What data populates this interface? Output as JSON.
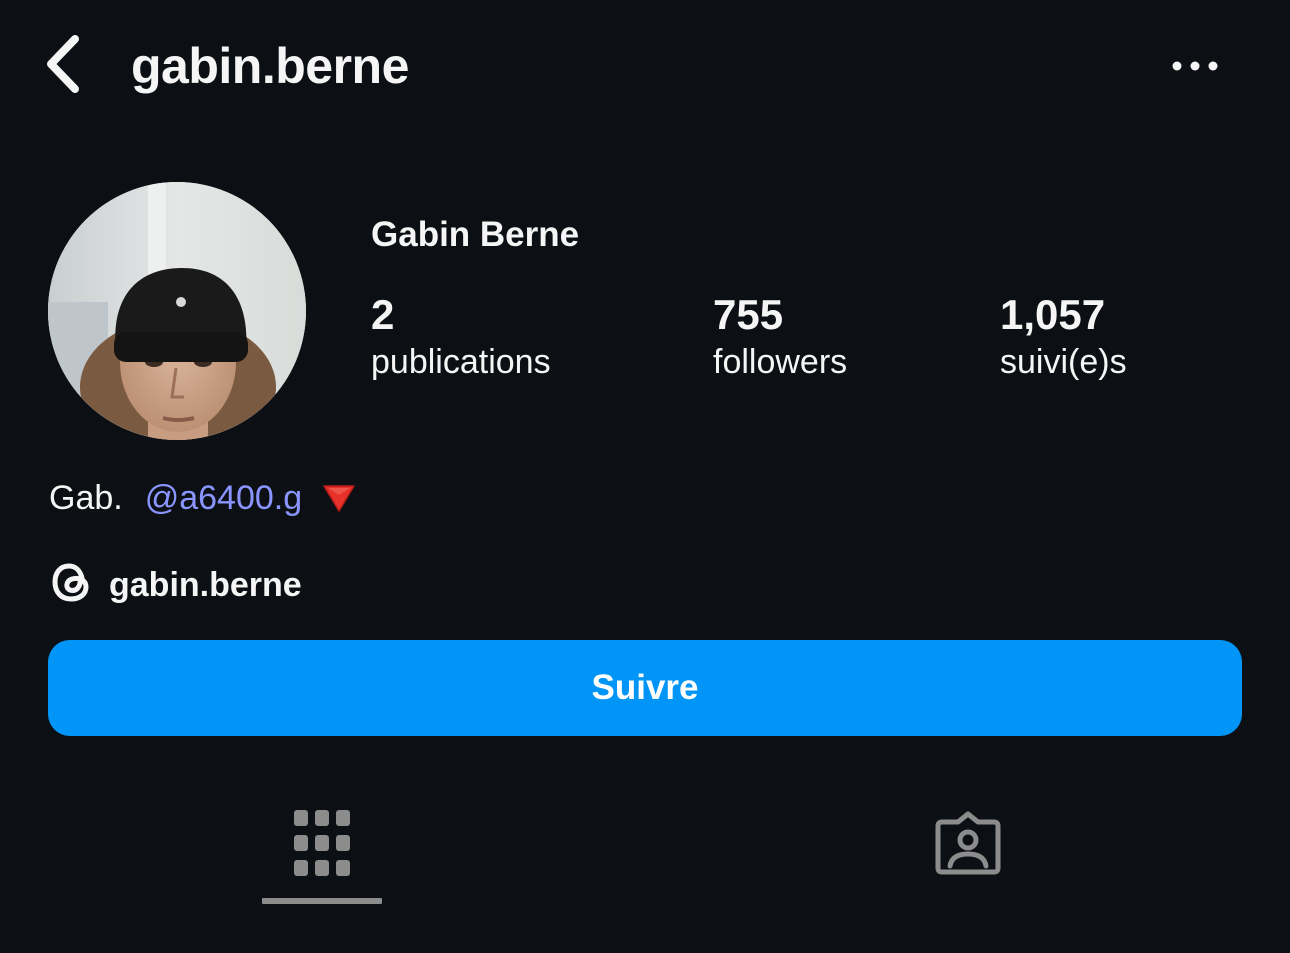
{
  "header": {
    "username": "gabin.berne"
  },
  "profile": {
    "full_name": "Gabin Berne",
    "stats": [
      {
        "value": "2",
        "label": "publications"
      },
      {
        "value": "755",
        "label": "followers"
      },
      {
        "value": "1,057",
        "label": "suivi(e)s"
      }
    ],
    "bio": {
      "text": "Gab.",
      "mention": "@a6400.g"
    },
    "threads_handle": "gabin.berne"
  },
  "actions": {
    "follow_label": "Suivre"
  },
  "colors": {
    "background": "#0c1014",
    "accent": "#0095f6",
    "mention": "#8a95ff",
    "tab_icon": "#8c8c8c"
  },
  "icons": {
    "back": "chevron-left-icon",
    "more": "more-horizontal-icon",
    "threads": "threads-icon",
    "grid_tab": "grid-icon",
    "tagged_tab": "tagged-person-icon",
    "bio_emoji": "red-triangle-down-icon"
  }
}
